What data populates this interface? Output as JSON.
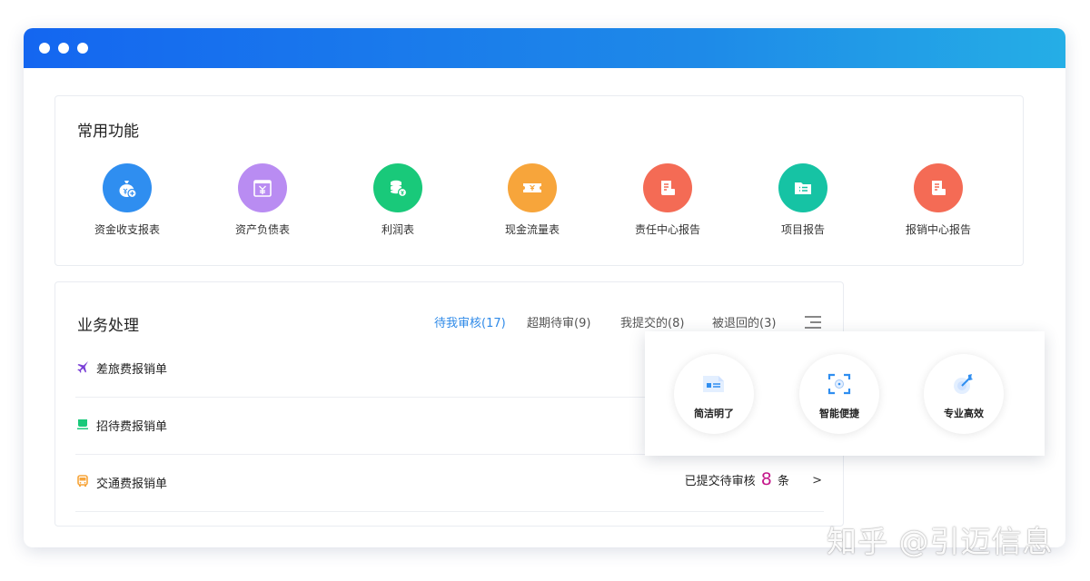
{
  "colors": {
    "titlebar_start": "#1466f0",
    "titlebar_end": "#25aee6",
    "active_tab": "#2f8ae8",
    "count_highlight": "#c4168a"
  },
  "common": {
    "title": "常用功能",
    "items": [
      {
        "label": "资金收支报表",
        "icon": "money-bag-icon",
        "color": "#2f8ef0"
      },
      {
        "label": "资产负债表",
        "icon": "yen-ledger-icon",
        "color": "#b98cf2"
      },
      {
        "label": "利润表",
        "icon": "coin-stack-icon",
        "color": "#19c97a"
      },
      {
        "label": "现金流量表",
        "icon": "ticket-icon",
        "color": "#f7a53b"
      },
      {
        "label": "责任中心报告",
        "icon": "report-doc-icon",
        "color": "#f46b55"
      },
      {
        "label": "项目报告",
        "icon": "folder-list-icon",
        "color": "#16c3a4"
      },
      {
        "label": "报销中心报告",
        "icon": "report-doc-icon",
        "color": "#f46b55"
      }
    ]
  },
  "business": {
    "title": "业务处理",
    "tabs": [
      {
        "label": "待我审核(17)",
        "active": true
      },
      {
        "label": "超期待审(9)",
        "active": false
      },
      {
        "label": "我提交的(8)",
        "active": false
      },
      {
        "label": "被退回的(3)",
        "active": false
      }
    ],
    "rows": [
      {
        "label": "差旅费报销单",
        "icon": "airplane-icon",
        "icon_color": "#7a3fd6"
      },
      {
        "label": "招待费报销单",
        "icon": "cup-icon",
        "icon_color": "#19c97a"
      },
      {
        "label": "交通费报销单",
        "icon": "bus-icon",
        "icon_color": "#f7a53b",
        "status_prefix": "已提交待审核",
        "status_count": "8",
        "status_suffix": "条",
        "arrow": ">"
      }
    ]
  },
  "features": [
    {
      "label": "简洁明了",
      "icon": "card-list-icon"
    },
    {
      "label": "智能便捷",
      "icon": "scan-focus-icon"
    },
    {
      "label": "专业高效",
      "icon": "target-dart-icon"
    }
  ],
  "watermark": "知乎 @引迈信息"
}
